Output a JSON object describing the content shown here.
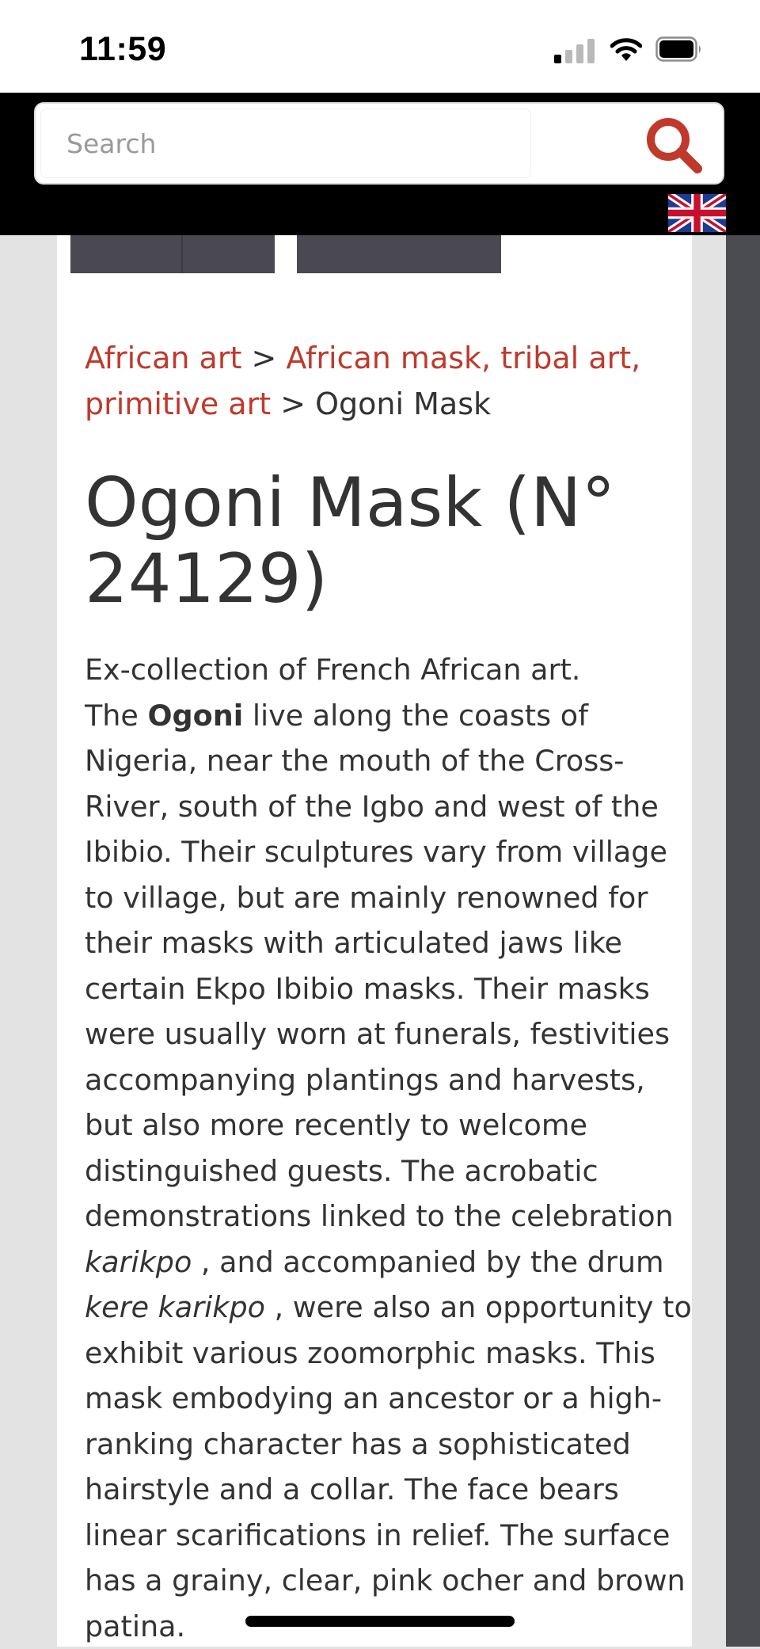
{
  "status_bar": {
    "time": "11:59"
  },
  "header": {
    "search_placeholder": "Search",
    "search_icon": "search-icon",
    "language_flag": "uk-flag-icon"
  },
  "breadcrumb": {
    "items": [
      "African art",
      "African mask, tribal art, primitive art"
    ],
    "separator": ">",
    "current": "Ogoni Mask"
  },
  "product": {
    "title": "Ogoni Mask (N° 24129)",
    "description": {
      "line1": "Ex-collection of French African art.",
      "p1": "The ",
      "p2": "Ogoni",
      "p3": " live along the coasts of Nigeria, near the mouth of the Cross-River, south of the Igbo and west of the Ibibio. Their sculptures vary from village to village, but are mainly renowned for their masks with articulated jaws like certain Ekpo Ibibio masks. Their masks were usually worn at funerals, festivities accompanying plantings and harvests, but also more recently to welcome distinguished guests. The acrobatic demonstrations linked to the celebration ",
      "p4": "karikpo",
      "p5": " , and accompanied by the drum ",
      "p6": "kere karikpo",
      "p7": " , were also an opportunity to exhibit various zoomorphic masks. This mask embodying an ancestor or a high-ranking character has a sophisticated hairstyle and a collar. The face bears linear scarifications in relief. The surface has a grainy, clear, pink ocher and brown patina."
    }
  },
  "colors": {
    "accent": "#c0392b",
    "header_bg": "#000000",
    "text": "#333333"
  }
}
